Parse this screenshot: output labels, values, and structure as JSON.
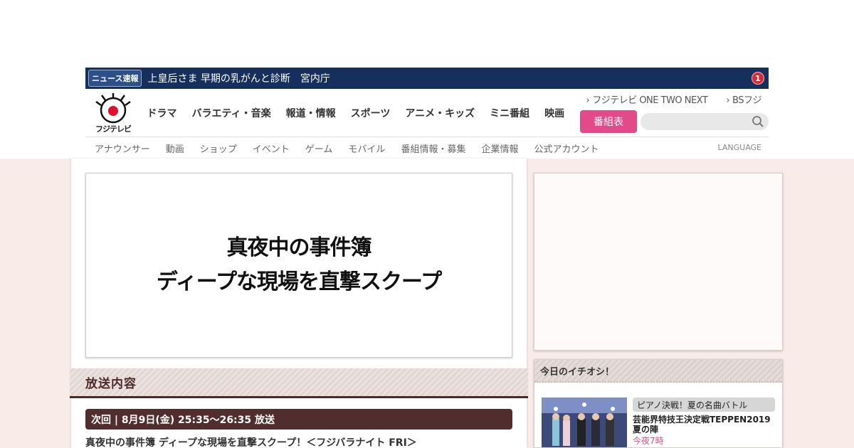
{
  "news": {
    "tag": "ニュース速報",
    "headline": "上皇后さま 早期の乳がんと診断　宮内庁",
    "count": "1"
  },
  "logo": {
    "text": "フジテレビ"
  },
  "main_nav": [
    "ドラマ",
    "バラエティ・音楽",
    "報道・情報",
    "スポーツ",
    "アニメ・キッズ",
    "ミニ番組",
    "映画"
  ],
  "sub_links": [
    "フジテレビ ONE TWO NEXT",
    "BSフジ"
  ],
  "program_button": "番組表",
  "search": {
    "placeholder": ""
  },
  "secondary_nav": [
    "アナウンサー",
    "動画",
    "ショップ",
    "イベント",
    "ゲーム",
    "モバイル",
    "番組情報・募集",
    "企業情報",
    "公式アカウント"
  ],
  "language_label": "LANGUAGE",
  "hero": {
    "line1": "真夜中の事件簿",
    "line2": "ディープな現場を直撃スクープ"
  },
  "broadcast": {
    "section_title": "放送内容",
    "next_label": "次回 | 8月9日(金) 25:35～26:35 放送",
    "program_title": "真夜中の事件簿 ディープな現場を直撃スクープ！＜フジバラナイト FRI＞"
  },
  "pick": {
    "header": "今日のイチオシ！",
    "tag": "ピアノ決戦！夏の名曲バトル",
    "title": "芸能界特技王決定戦TEPPEN2019夏の陣",
    "time": "今夜7時"
  },
  "colors": {
    "news_bar": "#16305d",
    "accent_pink": "#e24a8a",
    "section_brown": "#4d2a2a",
    "content_bg": "#f8ebe8"
  }
}
